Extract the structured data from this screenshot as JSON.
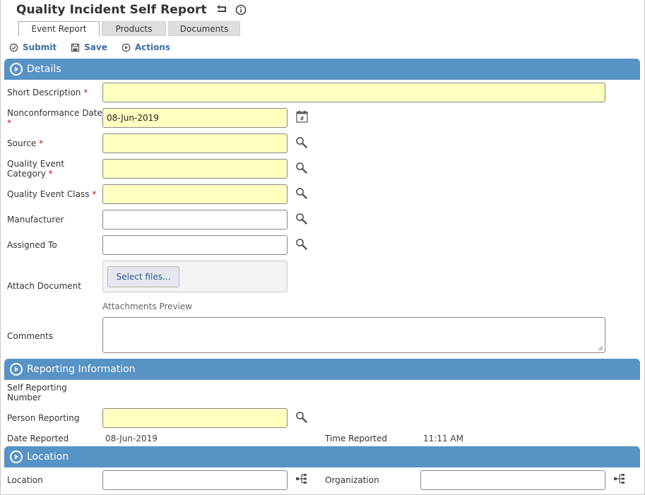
{
  "page": {
    "title": "Quality Incident Self Report"
  },
  "tabs": [
    {
      "label": "Event Report",
      "active": true
    },
    {
      "label": "Products",
      "active": false
    },
    {
      "label": "Documents",
      "active": false
    }
  ],
  "toolbar": {
    "submit_label": "Submit",
    "save_label": "Save",
    "actions_label": "Actions"
  },
  "sections": {
    "details": "Details",
    "reporting": "Reporting Information",
    "location": "Location"
  },
  "details": {
    "short_description": {
      "label": "Short Description",
      "value": ""
    },
    "nonconformance_date": {
      "label": "Nonconformance Date",
      "value": "08-Jun-2019"
    },
    "source": {
      "label": "Source",
      "value": ""
    },
    "quality_event_category": {
      "label_line1": "Quality Event",
      "label_line2": "Category",
      "value": ""
    },
    "quality_event_class": {
      "label": "Quality Event Class",
      "value": ""
    },
    "manufacturer": {
      "label": "Manufacturer",
      "value": ""
    },
    "assigned_to": {
      "label": "Assigned To",
      "value": ""
    },
    "attach_document": {
      "label": "Attach Document",
      "button": "Select files...",
      "preview": "Attachments Preview"
    },
    "comments": {
      "label": "Comments",
      "value": ""
    }
  },
  "reporting": {
    "self_reporting_number": {
      "label_line1": "Self Reporting",
      "label_line2": "Number"
    },
    "person_reporting": {
      "label": "Person Reporting",
      "value": ""
    },
    "date_reported": {
      "label": "Date Reported",
      "value": "08-Jun-2019"
    },
    "time_reported": {
      "label": "Time Reported",
      "value": "11:11 AM"
    }
  },
  "location": {
    "location": {
      "label": "Location",
      "value": ""
    },
    "organization": {
      "label": "Organization",
      "value": ""
    }
  },
  "required_marker": "*",
  "colors": {
    "section_header": "#5793c5",
    "required_field_bg": "#ffffc0",
    "link_blue": "#3a6ea5",
    "required_star": "#c01919"
  }
}
